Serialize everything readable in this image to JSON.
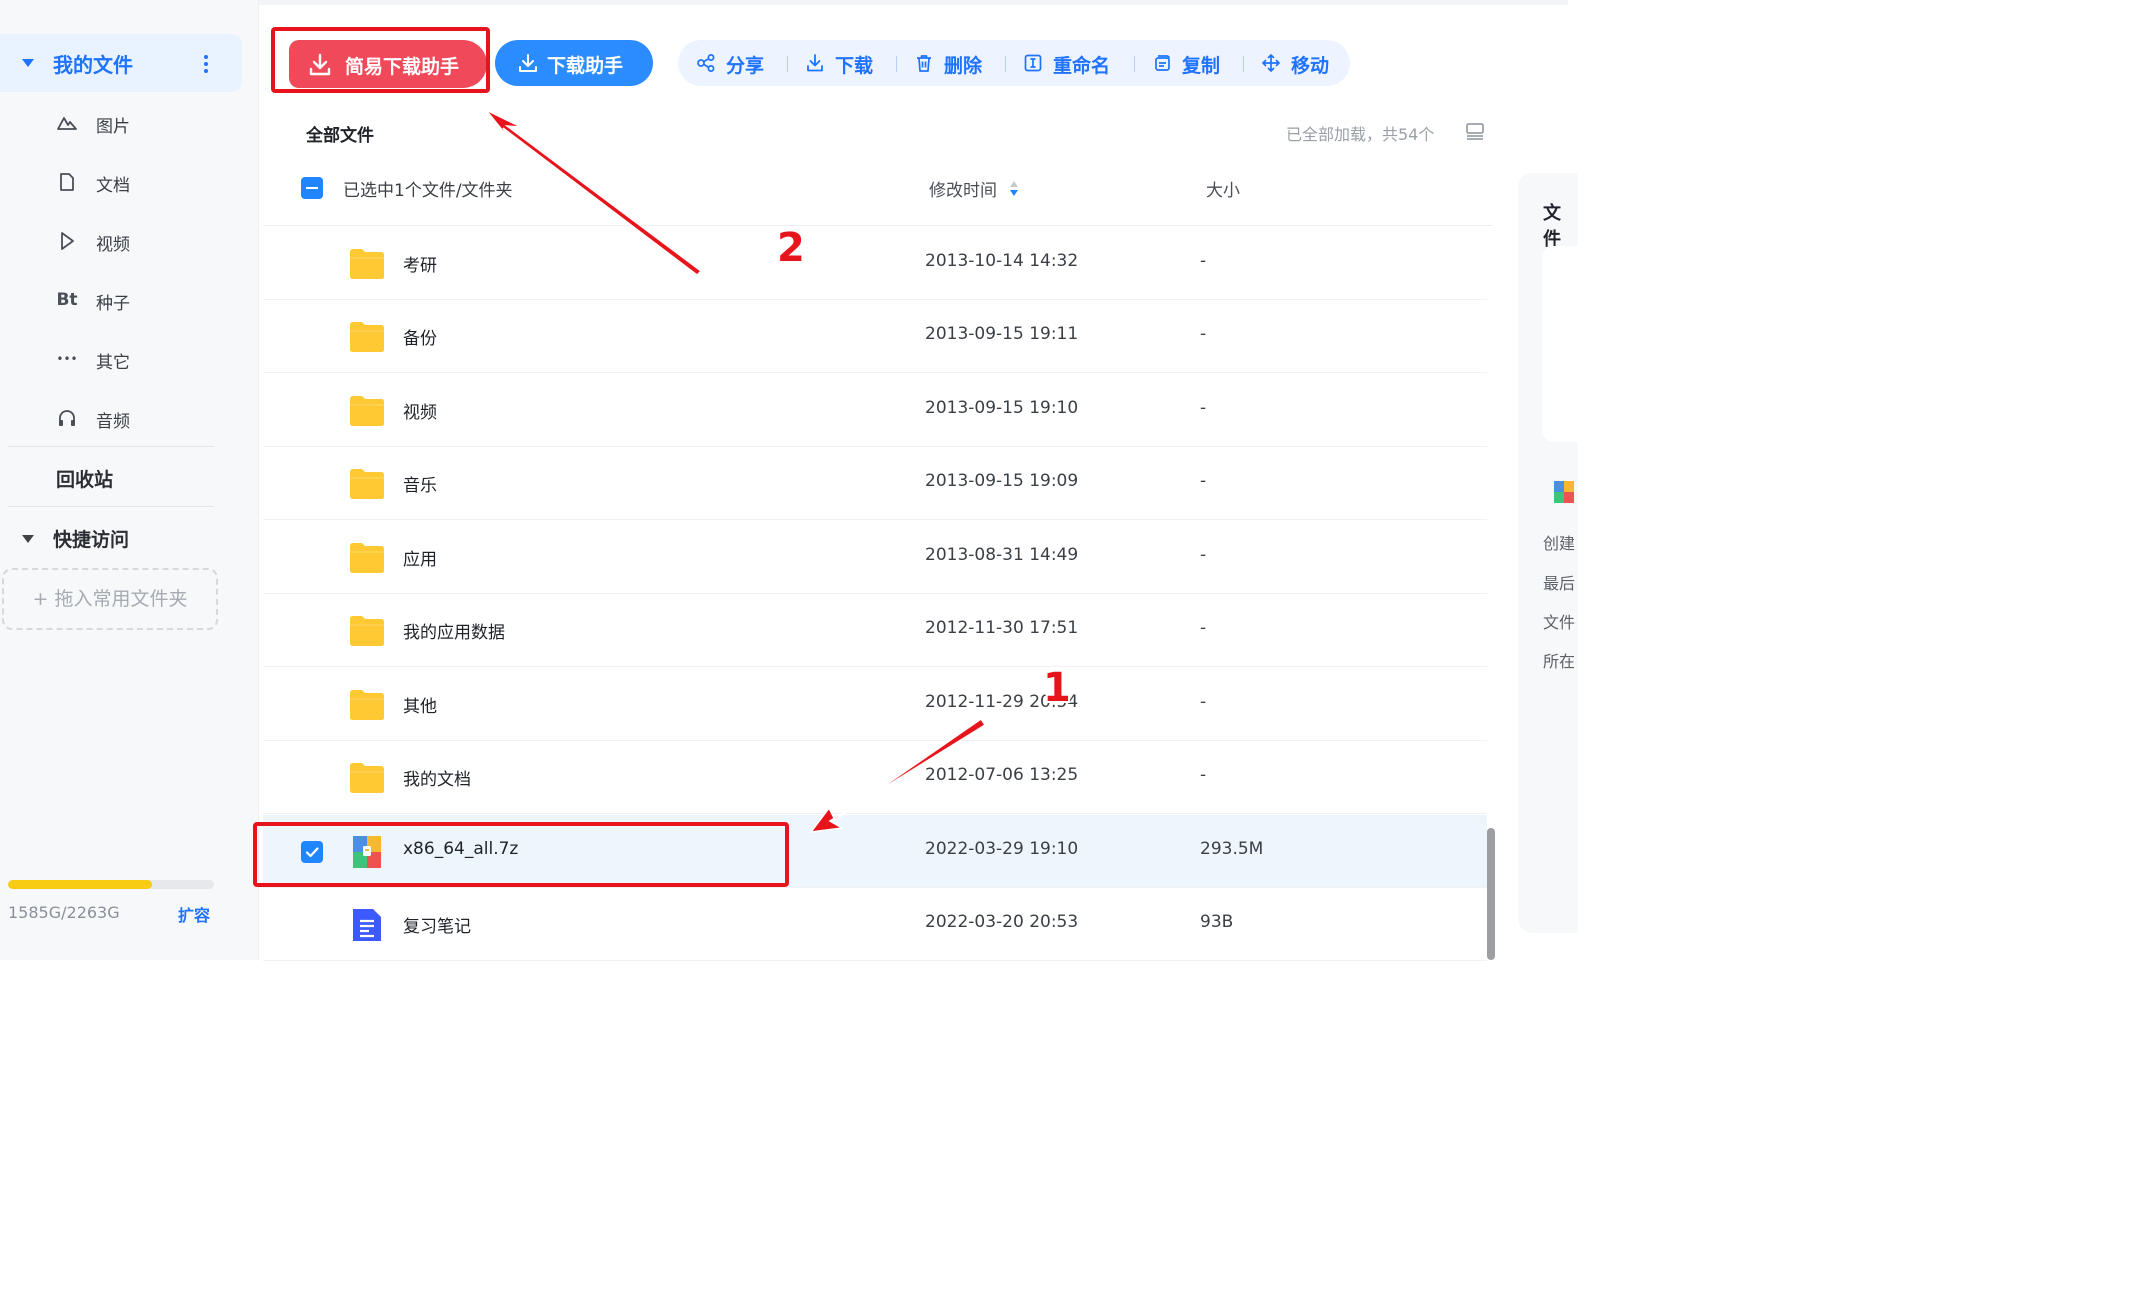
{
  "sidebar": {
    "my_files": "我的文件",
    "categories": [
      {
        "icon": "image-icon",
        "label": "图片"
      },
      {
        "icon": "document-icon",
        "label": "文档"
      },
      {
        "icon": "video-play-icon",
        "label": "视频"
      },
      {
        "icon": "bt-icon",
        "label": "种子",
        "icon_text": "Bt"
      },
      {
        "icon": "ellipsis-icon",
        "label": "其它",
        "icon_text": "•••"
      },
      {
        "icon": "headphones-icon",
        "label": "音频"
      }
    ],
    "recycle_bin": "回收站",
    "quick_access": "快捷访问",
    "drop_hint": "+ 拖入常用文件夹",
    "storage": {
      "text": "1585G/2263G",
      "used_fraction": 0.7,
      "expand": "扩容"
    }
  },
  "toolbar": {
    "simple_download": "简易下载助手",
    "download_helper": "下载助手",
    "actions": [
      {
        "icon": "share-icon",
        "label": "分享"
      },
      {
        "icon": "download-icon",
        "label": "下载"
      },
      {
        "icon": "trash-icon",
        "label": "删除"
      },
      {
        "icon": "rename-icon",
        "label": "重命名"
      },
      {
        "icon": "copy-icon",
        "label": "复制"
      },
      {
        "icon": "move-icon",
        "label": "移动"
      }
    ]
  },
  "list": {
    "title": "全部文件",
    "loaded_status": "已全部加载，共54个",
    "selected_text": "已选中1个文件/文件夹",
    "columns": {
      "time": "修改时间",
      "size": "大小"
    },
    "rows": [
      {
        "type": "folder",
        "name": "考研",
        "time": "2013-10-14 14:32",
        "size": "-"
      },
      {
        "type": "folder",
        "name": "备份",
        "time": "2013-09-15 19:11",
        "size": "-"
      },
      {
        "type": "folder",
        "name": "视频",
        "time": "2013-09-15 19:10",
        "size": "-"
      },
      {
        "type": "folder",
        "name": "音乐",
        "time": "2013-09-15 19:09",
        "size": "-"
      },
      {
        "type": "folder",
        "name": "应用",
        "time": "2013-08-31 14:49",
        "size": "-"
      },
      {
        "type": "folder",
        "name": "我的应用数据",
        "time": "2012-11-30 17:51",
        "size": "-"
      },
      {
        "type": "folder",
        "name": "其他",
        "time": "2012-11-29 20:54",
        "size": "-"
      },
      {
        "type": "folder",
        "name": "我的文档",
        "time": "2012-07-06 13:25",
        "size": "-"
      },
      {
        "type": "archive",
        "name": "x86_64_all.7z",
        "time": "2022-03-29 19:10",
        "size": "293.5M",
        "selected": true
      },
      {
        "type": "note",
        "name": "复习笔记",
        "time": "2022-03-20 20:53",
        "size": "93B"
      }
    ]
  },
  "annotations": {
    "marker_1": "1",
    "marker_2": "2"
  },
  "detail_panel": {
    "title": "文件",
    "meta": [
      "创建",
      "最后",
      "文件",
      "所在"
    ]
  },
  "colors": {
    "accent": "#1f73ff",
    "danger": "#f04a5a",
    "annotation": "#e8141b",
    "folder": "#ffc933"
  }
}
